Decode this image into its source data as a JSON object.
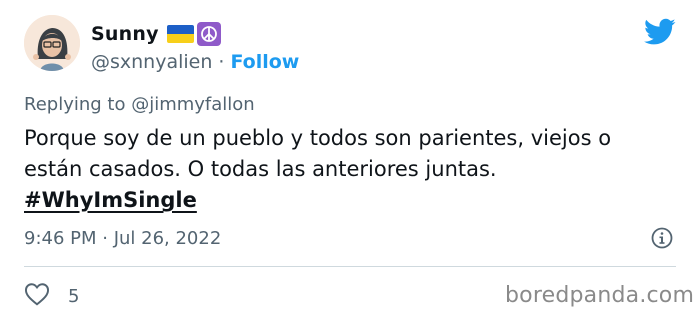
{
  "user": {
    "display_name": "Sunny",
    "handle": "@sxnnyalien",
    "separator": "·",
    "follow_label": "Follow"
  },
  "tweet": {
    "replying_to": "Replying to @jimmyfallon",
    "text_line1": "Porque soy de un pueblo y todos son parientes, viejos o",
    "text_line2": "están casados. O todas las anteriores juntas.",
    "hashtag": "#WhyImSingle",
    "timestamp": "9:46 PM · Jul 26, 2022",
    "like_count": "5"
  },
  "watermark": "boredpanda.com",
  "icons": {
    "brand": "twitter-bird-icon",
    "flag": "ukraine-flag-emoji",
    "peace": "peace-symbol-emoji",
    "info": "info-icon",
    "like": "heart-icon"
  },
  "colors": {
    "accent": "#1d9bf0",
    "text": "#0f1419",
    "muted": "#536471",
    "divider": "#cfd9de"
  }
}
